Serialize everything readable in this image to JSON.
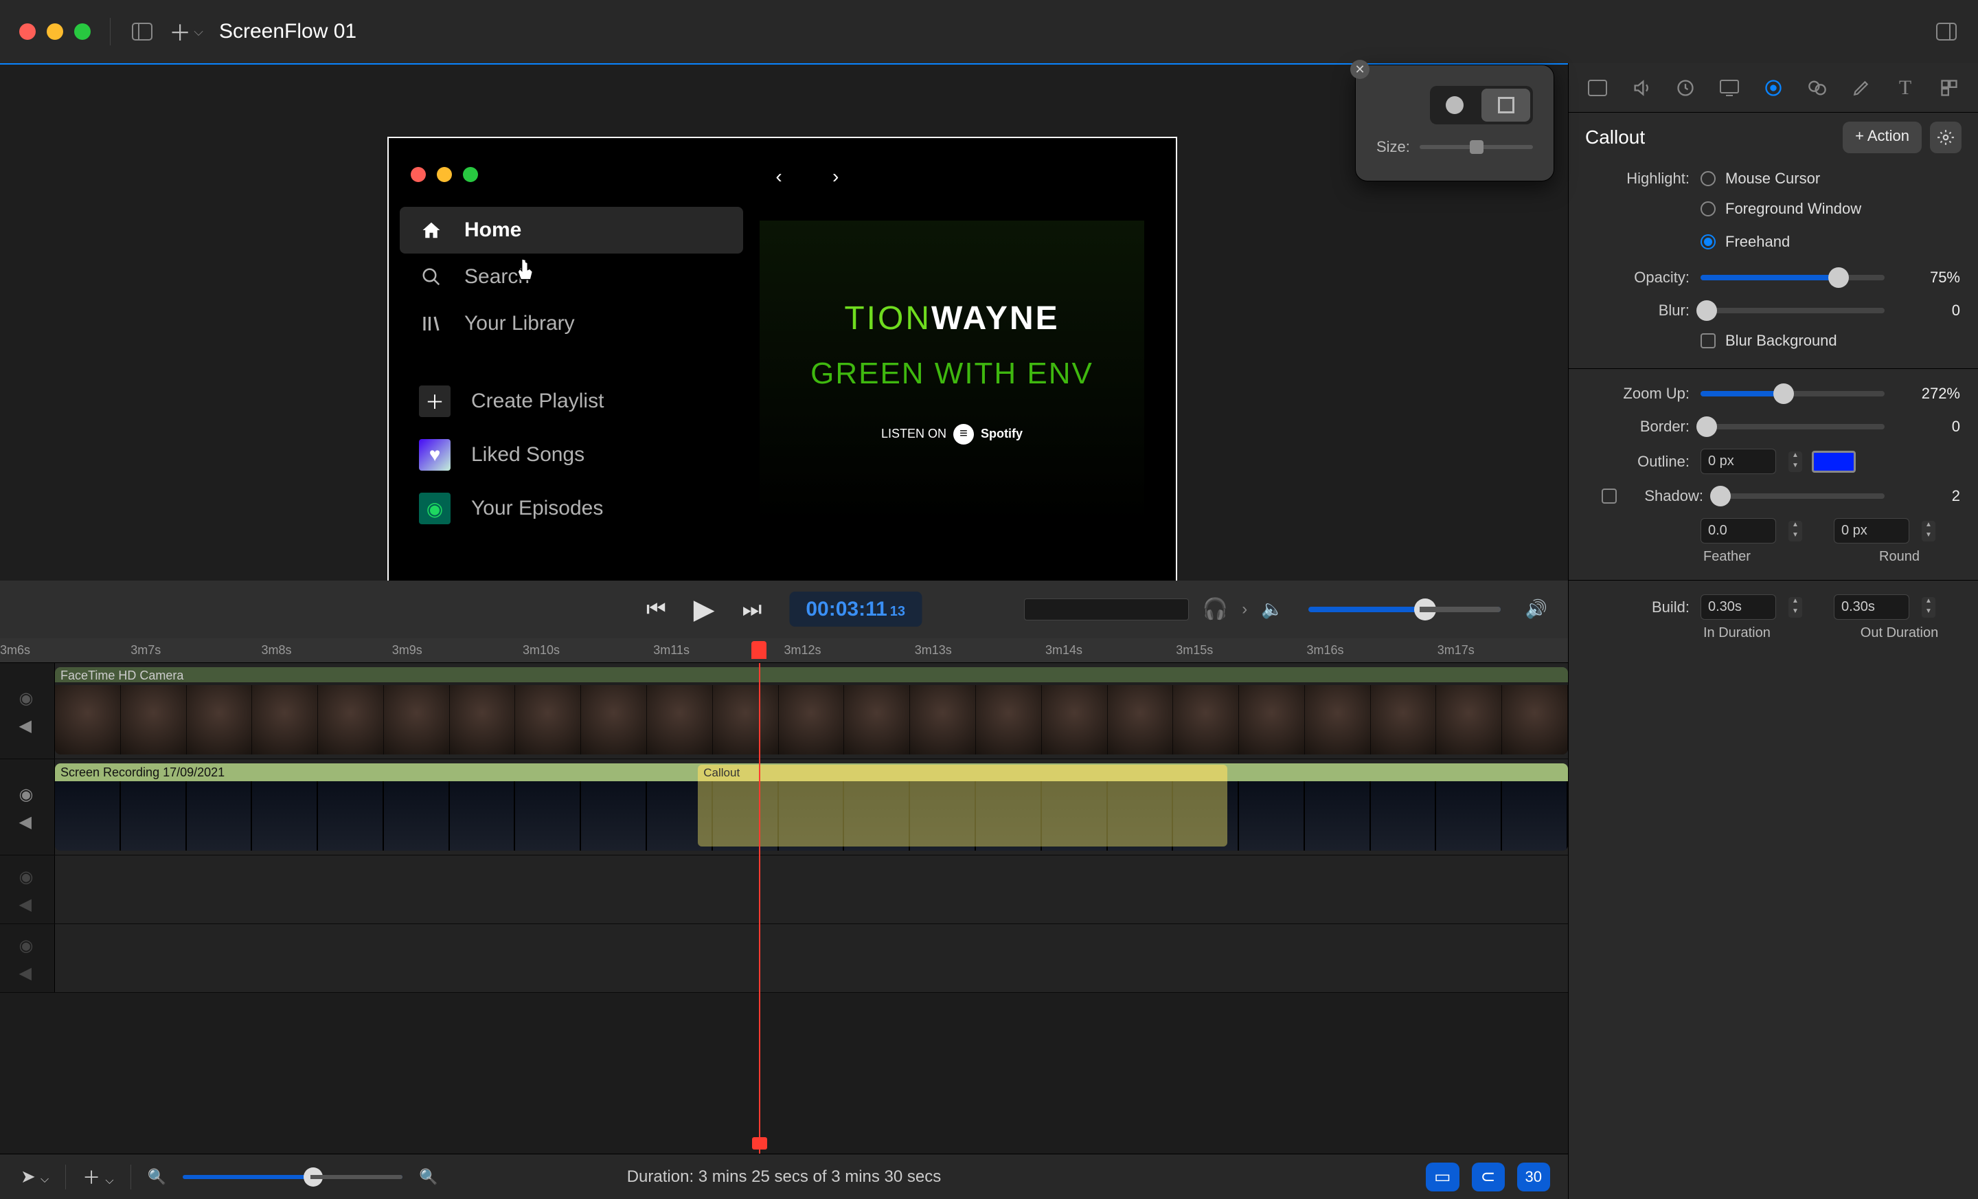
{
  "toolbar": {
    "title": "ScreenFlow 01"
  },
  "size_popup": {
    "label": "Size:"
  },
  "inspector": {
    "panel_title": "Callout",
    "add_action": "+ Action",
    "highlight": {
      "label": "Highlight:",
      "opt_mouse": "Mouse Cursor",
      "opt_fg": "Foreground Window",
      "opt_free": "Freehand"
    },
    "opacity": {
      "label": "Opacity:",
      "value": "75%",
      "pct": 75
    },
    "blur": {
      "label": "Blur:",
      "value": "0",
      "pct": 0
    },
    "blur_bg": {
      "label": "Blur Background"
    },
    "zoom_up": {
      "label": "Zoom Up:",
      "value": "272%",
      "pct": 45
    },
    "border": {
      "label": "Border:",
      "value": "0",
      "pct": 0
    },
    "outline": {
      "label": "Outline:",
      "value": "0 px",
      "color": "#0020ff"
    },
    "shadow": {
      "label": "Shadow:",
      "value": "2",
      "pct": 0
    },
    "feather": {
      "label": "Feather",
      "value": "0.0"
    },
    "round": {
      "label": "Round",
      "value": "0 px"
    },
    "build": {
      "label": "Build:",
      "in_value": "0.30s",
      "in_label": "In Duration",
      "out_value": "0.30s",
      "out_label": "Out Duration"
    }
  },
  "transport": {
    "timecode": "00:03:11",
    "frames": "13"
  },
  "ruler": [
    "3m6s",
    "3m7s",
    "3m8s",
    "3m9s",
    "3m10s",
    "3m11s",
    "3m12s",
    "3m13s",
    "3m14s",
    "3m15s",
    "3m16s",
    "3m17s"
  ],
  "tracks": {
    "camera": "FaceTime HD Camera",
    "screen": "Screen Recording 17/09/2021",
    "callout": "Callout"
  },
  "bottom": {
    "duration": "Duration: 3 mins 25 secs of 3 mins 30 secs",
    "fps": "30"
  },
  "spotify": {
    "home": "Home",
    "search": "Search",
    "library": "Your Library",
    "create": "Create Playlist",
    "liked": "Liked Songs",
    "episodes": "Your Episodes",
    "album_line1a": "TION",
    "album_line1b": "WAYNE",
    "album_line2": "GREEN WITH ENV",
    "listen": "LISTEN ON",
    "listen_brand": "Spotify"
  }
}
